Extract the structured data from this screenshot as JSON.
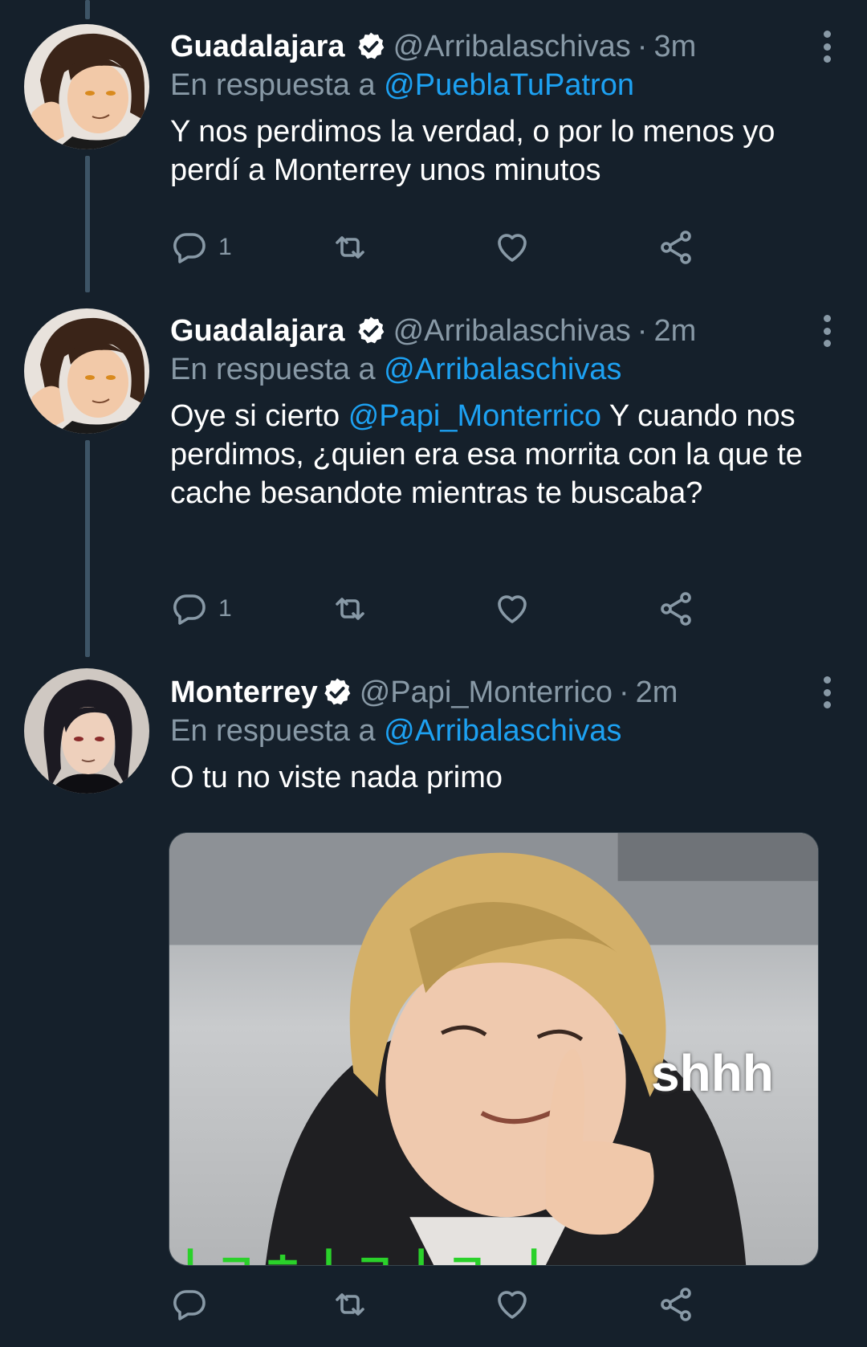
{
  "tweets": [
    {
      "name": "Guadalajara",
      "handle": "@Arribalaschivas",
      "time": "3m",
      "reply_label": "En respuesta a",
      "reply_to": "@PueblaTuPatron",
      "text": "Y nos perdimos la verdad, o por lo menos yo perdí a Monterrey unos minutos",
      "reply_count": "1"
    },
    {
      "name": "Guadalajara",
      "handle": "@Arribalaschivas",
      "time": "2m",
      "reply_label": "En respuesta a",
      "reply_to": "@Arribalaschivas",
      "text_before": "Oye si cierto ",
      "text_mention": "@Papi_Monterrico",
      "text_after": " Y cuando nos perdimos, ¿quien era esa morrita con la que te cache besandote mientras te buscaba?",
      "reply_count": "1"
    },
    {
      "name": "Monterrey",
      "handle": "@Papi_Monterrico",
      "time": "2m",
      "reply_label": "En respuesta a",
      "reply_to": "@Arribalaschivas",
      "text": "O tu no viste nada primo",
      "reply_count": "",
      "media_caption": "shhh",
      "media_subtitle": "ㅣㄱㅎㅣㄱㅣㄱ ㅣ"
    }
  ],
  "separator": "·",
  "icons": {
    "reply": "reply-icon",
    "retweet": "retweet-icon",
    "like": "heart-icon",
    "share": "share-icon",
    "verified": "verified-badge-icon",
    "more": "more-options-icon"
  },
  "colors": {
    "background": "#15202b",
    "secondary_text": "#8899a6",
    "link": "#1da1f2",
    "thread_line": "#3d5466"
  }
}
